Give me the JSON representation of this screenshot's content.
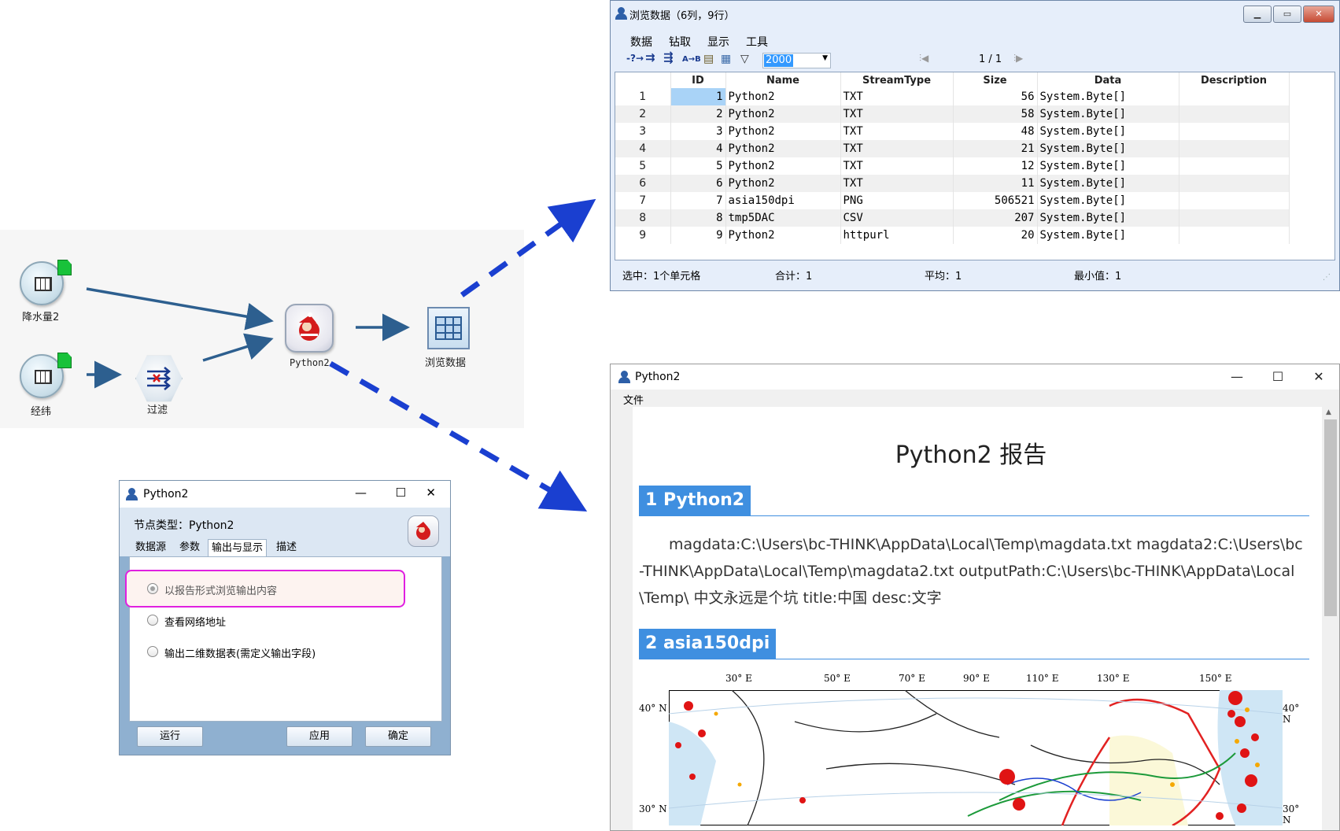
{
  "flow": {
    "nodes": {
      "rainfall": "降水量2",
      "lonlat": "经纬",
      "filter": "过滤",
      "python": "Python2",
      "browse": "浏览数据"
    }
  },
  "data_window": {
    "title": "浏览数据（6列，9行）",
    "menu": [
      "数据",
      "钻取",
      "显示",
      "工具"
    ],
    "toolbar": {
      "limit_value": "2000",
      "page_indicator": "1 / 1"
    },
    "columns": [
      "ID",
      "Name",
      "StreamType",
      "Size",
      "Data",
      "Description"
    ],
    "rows": [
      [
        "1",
        "1",
        "Python2",
        "TXT",
        "56",
        "System.Byte[]",
        ""
      ],
      [
        "2",
        "2",
        "Python2",
        "TXT",
        "58",
        "System.Byte[]",
        ""
      ],
      [
        "3",
        "3",
        "Python2",
        "TXT",
        "48",
        "System.Byte[]",
        ""
      ],
      [
        "4",
        "4",
        "Python2",
        "TXT",
        "21",
        "System.Byte[]",
        ""
      ],
      [
        "5",
        "5",
        "Python2",
        "TXT",
        "12",
        "System.Byte[]",
        ""
      ],
      [
        "6",
        "6",
        "Python2",
        "TXT",
        "11",
        "System.Byte[]",
        ""
      ],
      [
        "7",
        "7",
        "asia150dpi",
        "PNG",
        "506521",
        "System.Byte[]",
        ""
      ],
      [
        "8",
        "8",
        "tmp5DAC",
        "CSV",
        "207",
        "System.Byte[]",
        ""
      ],
      [
        "9",
        "9",
        "Python2",
        "httpurl",
        "20",
        "System.Byte[]",
        ""
      ]
    ],
    "status": {
      "selected": "选中：1个单元格",
      "sum": "合计：1",
      "avg": "平均：1",
      "min": "最小值：1"
    }
  },
  "report_window": {
    "title": "Python2",
    "menu_file": "文件",
    "heading": "Python2 报告",
    "section1": "1 Python2",
    "paragraph": "magdata:C:\\Users\\bc-THINK\\AppData\\Local\\Temp\\magdata.txt magdata2:C:\\Users\\bc-THINK\\AppData\\Local\\Temp\\magdata2.txt outputPath:C:\\Users\\bc-THINK\\AppData\\Local\\Temp\\ 中文永远是个坑 title:中国 desc:文字",
    "section2": "2 asia150dpi",
    "map": {
      "lon_labels": [
        "30° E",
        "50° E",
        "70° E",
        "90° E",
        "110° E",
        "130° E",
        "150° E"
      ],
      "lat_labels": [
        "40° N",
        "30° N"
      ]
    }
  },
  "dialog": {
    "title": "Python2",
    "node_type": "节点类型：Python2",
    "tabs": [
      "数据源",
      "参数",
      "输出与显示",
      "描述"
    ],
    "options": [
      "以报告形式浏览输出内容",
      "查看网络地址",
      "输出二维数据表(需定义输出字段)"
    ],
    "buttons": {
      "run": "运行",
      "apply": "应用",
      "ok": "确定"
    }
  },
  "colors": {
    "flow_arrow": "#2d5f8f",
    "dashed_arrow": "#1a3fd0",
    "report_accent": "#3f8fe0",
    "highlight_border": "#e020e0"
  }
}
